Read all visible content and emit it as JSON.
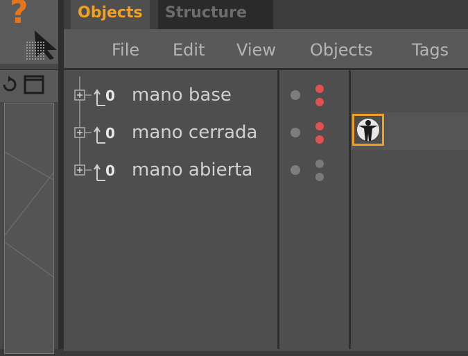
{
  "help_icon": {
    "glyph": "?",
    "icon": "help-question-icon"
  },
  "tabs": [
    {
      "label": "Objects",
      "active": true
    },
    {
      "label": "Structure",
      "active": false
    }
  ],
  "menu": {
    "items": [
      "File",
      "Edit",
      "View",
      "Objects",
      "Tags"
    ]
  },
  "objects": [
    {
      "name": "mano base",
      "layer_dots": [
        "#e25050",
        "#e25050"
      ],
      "has_tag": false
    },
    {
      "name": "mano cerrada",
      "layer_dots": [
        "#e25050",
        "#e25050"
      ],
      "has_tag": true
    },
    {
      "name": "mano abierta",
      "layer_dots": [
        "#7a7a7a",
        "#7a7a7a"
      ],
      "has_tag": false
    }
  ],
  "colors": {
    "accent": "#f5a020",
    "panel": "#4e4e4e",
    "menubar": "#595959",
    "red_dot": "#e25050"
  }
}
